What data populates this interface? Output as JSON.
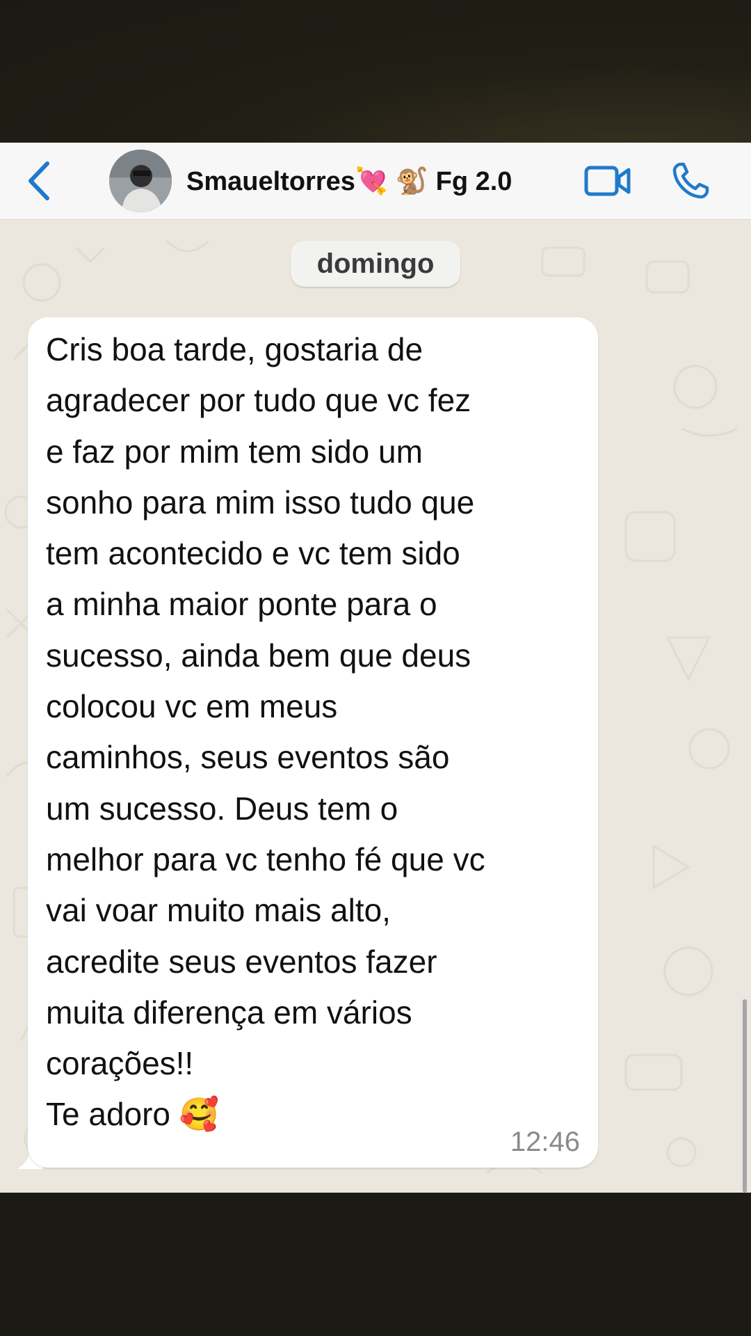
{
  "header": {
    "back_icon": "chevron-left-icon",
    "contact_name": "Smaueltorres💘 🐒 Fg 2.0",
    "video_icon": "video-camera-icon",
    "call_icon": "phone-icon",
    "accent_color": "#1f7acb"
  },
  "chat": {
    "date_label": "domingo",
    "messages": [
      {
        "text": "Cris boa tarde, gostaria de\nagradecer por tudo que vc fez\ne faz por mim tem sido um\nsonho para mim isso tudo que\ntem acontecido e vc tem sido\na minha maior ponte para o\nsucesso, ainda bem que deus\ncolocou vc em meus\ncaminhos, seus eventos são\num sucesso. Deus tem o\nmelhor para vc tenho fé que vc\nvai voar muito mais alto,\nacredite seus eventos fazer\nmuita diferença em vários\ncorações!!\nTe adoro 🥰",
        "time": "12:46",
        "direction": "incoming"
      }
    ]
  },
  "colors": {
    "chat_background": "#ebe6de",
    "bubble": "#ffffff",
    "header": "#f7f7f7"
  }
}
